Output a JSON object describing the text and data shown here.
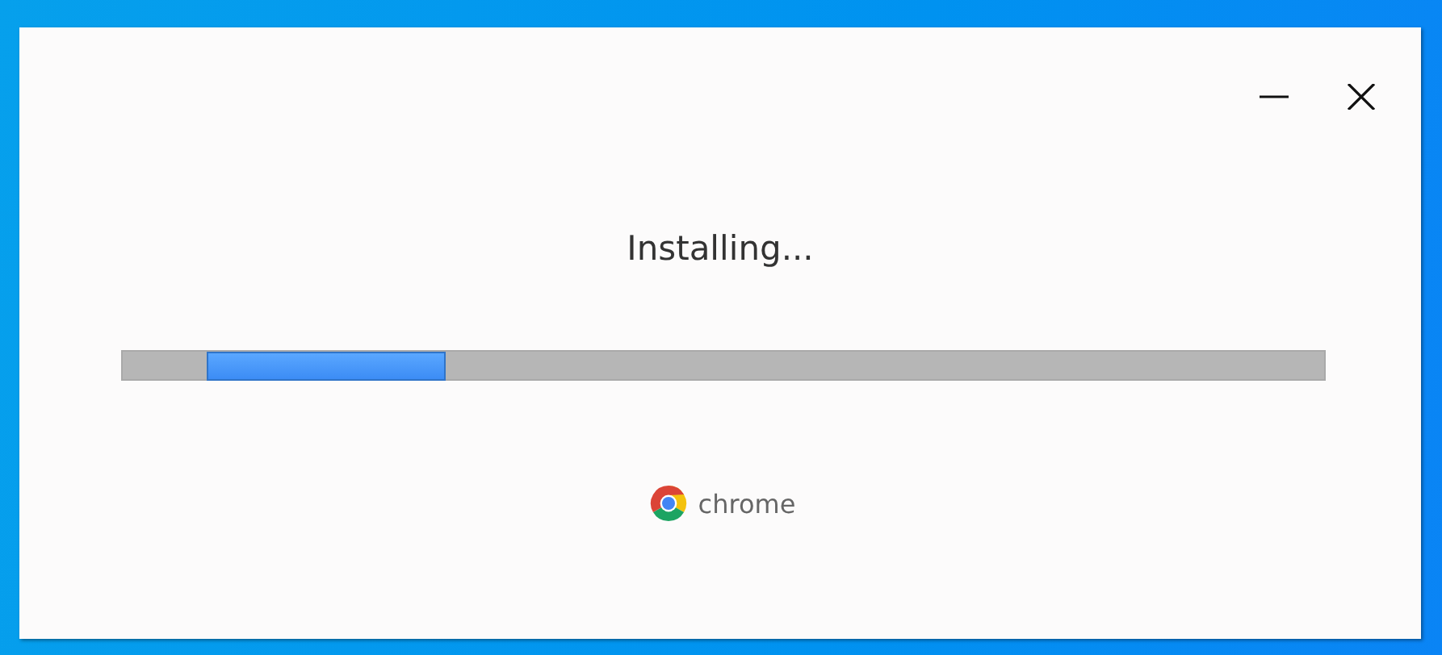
{
  "window": {
    "controls": [
      {
        "kind": "minimize"
      },
      {
        "kind": "close"
      }
    ]
  },
  "status": "Installing...",
  "progress": {
    "indeterminate": true
  },
  "brand": {
    "name": "chrome"
  }
}
